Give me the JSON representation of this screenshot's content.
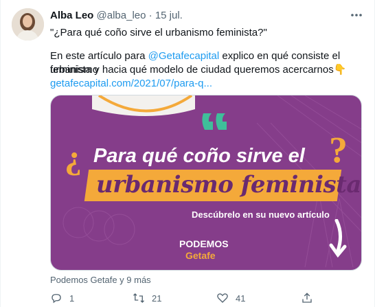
{
  "tweet": {
    "author_name": "Alba Leo",
    "author_handle": "@alba_leo",
    "separator": "·",
    "date": "15 jul.",
    "line1": "\"¿Para qué coño sirve el urbanismo feminista?\"",
    "line2_prefix": "En este artículo para ",
    "mention": "@Getafecapital",
    "line2_suffix": " explico en qué consiste el urbanismo",
    "line3": "feminista y hacia qué modelo de ciudad queremos acercarnos",
    "emoji": "👇",
    "url": "getafecapital.com/2021/07/para-q...",
    "tagged": "Podemos Getafe y 9 más"
  },
  "media": {
    "headline1": "Para qué coño sirve el",
    "headline2": "urbanismo feminista",
    "open_q": "¿",
    "close_q": "?",
    "subline": "Descúbrelo en su nuevo artículo",
    "brand1": "PODEMOS",
    "brand2": "Getafe",
    "colors": {
      "purple": "#8a3d8f",
      "orange": "#f4a93a",
      "teal": "#3fbf9a"
    }
  },
  "actions": {
    "reply_count": "1",
    "retweet_count": "21",
    "like_count": "41",
    "reply_icon": "reply-icon",
    "retweet_icon": "retweet-icon",
    "like_icon": "heart-icon",
    "share_icon": "share-icon"
  }
}
